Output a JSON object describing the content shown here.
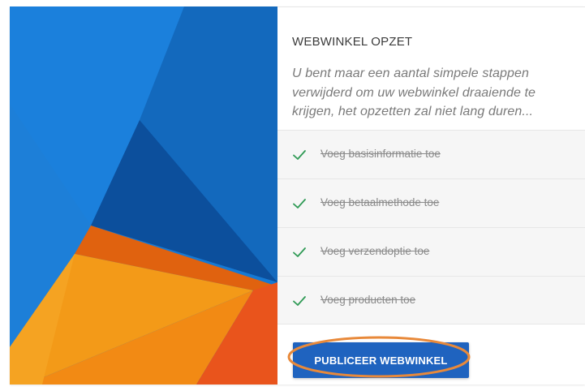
{
  "header": {
    "title": "WEBWINKEL OPZET",
    "description": "U bent maar een aantal simpele stappen verwijderd om uw webwinkel draaiende te krijgen, het opzetten zal niet lang duren..."
  },
  "steps": [
    {
      "label": "Voeg basisinformatie toe",
      "completed": true
    },
    {
      "label": "Voeg betaalmethode toe",
      "completed": true
    },
    {
      "label": "Voeg verzendoptie toe",
      "completed": true
    },
    {
      "label": "Voeg producten toe",
      "completed": true
    }
  ],
  "publish_button": {
    "label": "PUBLICEER WEBWINKEL"
  },
  "colors": {
    "primary": "#1f63bf",
    "check": "#2f9a55",
    "highlight": "#e8893a",
    "art_blue": "#1a73c9",
    "art_dark_blue": "#0f4f9e",
    "art_orange": "#f39a18",
    "art_red": "#e9541c"
  }
}
